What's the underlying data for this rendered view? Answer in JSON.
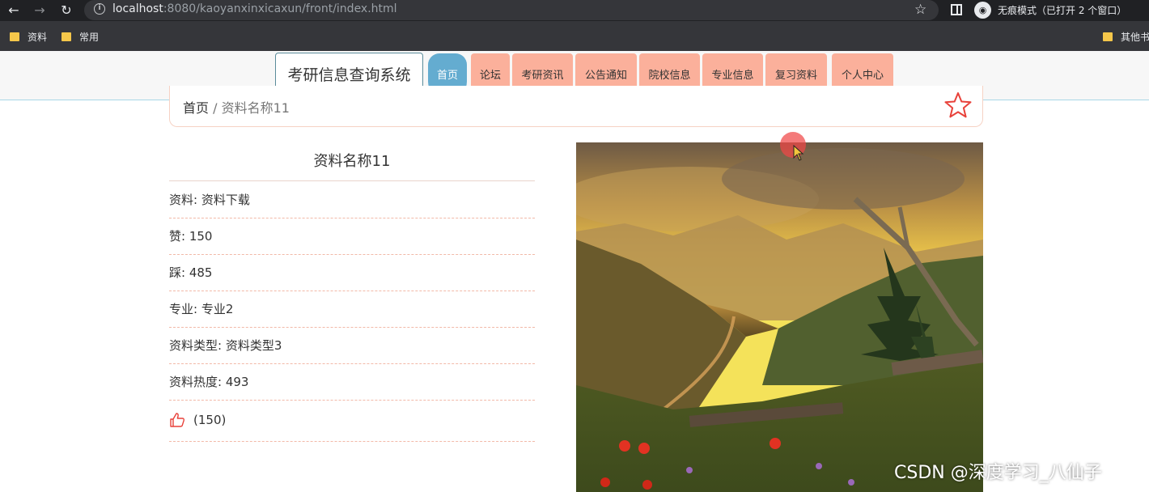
{
  "browser": {
    "url_host": "localhost",
    "url_rest": ":8080/kaoyanxinxicaxun/front/index.html",
    "incognito_label": "无痕模式（已打开 2 个窗口）",
    "bookmarks": [
      "资料",
      "常用"
    ],
    "other_bookmarks": "其他书"
  },
  "header": {
    "site_title": "考研信息查询系统",
    "nav": [
      "首页",
      "论坛",
      "考研资讯",
      "公告通知",
      "院校信息",
      "专业信息",
      "复习资料",
      "个人中心"
    ],
    "active_nav": "首页"
  },
  "breadcrumb": {
    "home": "首页",
    "separator": "/",
    "current": "资料名称11"
  },
  "detail": {
    "title": "资料名称11",
    "rows": [
      "资料: 资料下载",
      "赞: 150",
      "踩: 485",
      "专业: 专业2",
      "资料类型: 资料类型3",
      "资料热度: 493"
    ],
    "like_count": "(150)"
  },
  "watermark": "CSDN @深度学习_八仙子",
  "colors": {
    "nav_bg": "#fbb09b",
    "nav_active": "#64acd0",
    "accent_red": "#e8413a"
  }
}
